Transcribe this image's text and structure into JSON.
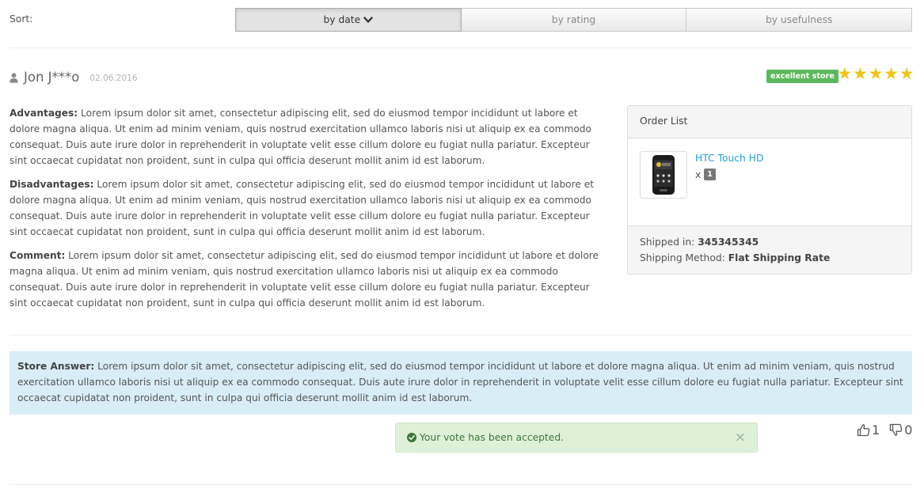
{
  "sort": {
    "label": "Sort:",
    "options": [
      "by date",
      "by rating",
      "by usefulness"
    ]
  },
  "review": {
    "author": "Jon J***o",
    "date": "02.06.2016",
    "badge": "excellent store",
    "rating": 5,
    "rating_max": 5,
    "advantages_label": "Advantages:",
    "advantages_text": "Lorem ipsum dolor sit amet, consectetur adipiscing elit, sed do eiusmod tempor incididunt ut labore et dolore magna aliqua. Ut enim ad minim veniam, quis nostrud exercitation ullamco laboris nisi ut aliquip ex ea commodo consequat. Duis aute irure dolor in reprehenderit in voluptate velit esse cillum dolore eu fugiat nulla pariatur. Excepteur sint occaecat cupidatat non proident, sunt in culpa qui officia deserunt mollit anim id est laborum.",
    "disadvantages_label": "Disadvantages:",
    "disadvantages_text": "Lorem ipsum dolor sit amet, consectetur adipiscing elit, sed do eiusmod tempor incididunt ut labore et dolore magna aliqua. Ut enim ad minim veniam, quis nostrud exercitation ullamco laboris nisi ut aliquip ex ea commodo consequat. Duis aute irure dolor in reprehenderit in voluptate velit esse cillum dolore eu fugiat nulla pariatur. Excepteur sint occaecat cupidatat non proident, sunt in culpa qui officia deserunt mollit anim id est laborum.",
    "comment_label": "Comment:",
    "comment_text": "Lorem ipsum dolor sit amet, consectetur adipiscing elit, sed do eiusmod tempor incididunt ut labore et dolore magna aliqua. Ut enim ad minim veniam, quis nostrud exercitation ullamco laboris nisi ut aliquip ex ea commodo consequat. Duis aute irure dolor in reprehenderit in voluptate velit esse cillum dolore eu fugiat nulla pariatur. Excepteur sint occaecat cupidatat non proident, sunt in culpa qui officia deserunt mollit anim id est laborum."
  },
  "order": {
    "title": "Order List",
    "product_name": "HTC Touch HD",
    "qty_prefix": "x",
    "qty": "1",
    "shipped_label": "Shipped in:",
    "shipped_value": "345345345",
    "method_label": "Shipping Method:",
    "method_value": "Flat Shipping Rate"
  },
  "answer": {
    "label": "Store Answer:",
    "text": "Lorem ipsum dolor sit amet, consectetur adipiscing elit, sed do eiusmod tempor incididunt ut labore et dolore magna aliqua. Ut enim ad minim veniam, quis nostrud exercitation ullamco laboris nisi ut aliquip ex ea commodo consequat. Duis aute irure dolor in reprehenderit in voluptate velit esse cillum dolore eu fugiat nulla pariatur. Excepteur sint occaecat cupidatat non proident, sunt in culpa qui officia deserunt mollit anim id est laborum."
  },
  "alert": {
    "message": "Your vote has been accepted.",
    "close": "×"
  },
  "votes": {
    "up": "1",
    "down": "0"
  },
  "colors": {
    "star": "#f0c419",
    "badge": "#5cb85c",
    "link": "#23a1d1",
    "answer_bg": "#d9edf7",
    "alert_bg": "#dff0d8",
    "alert_text": "#3c763d"
  },
  "icons": {
    "sort_active": "chevron-down-icon",
    "author": "user-icon",
    "alert": "check-circle-icon",
    "vote_up": "thumbs-up-icon",
    "vote_down": "thumbs-down-icon"
  }
}
